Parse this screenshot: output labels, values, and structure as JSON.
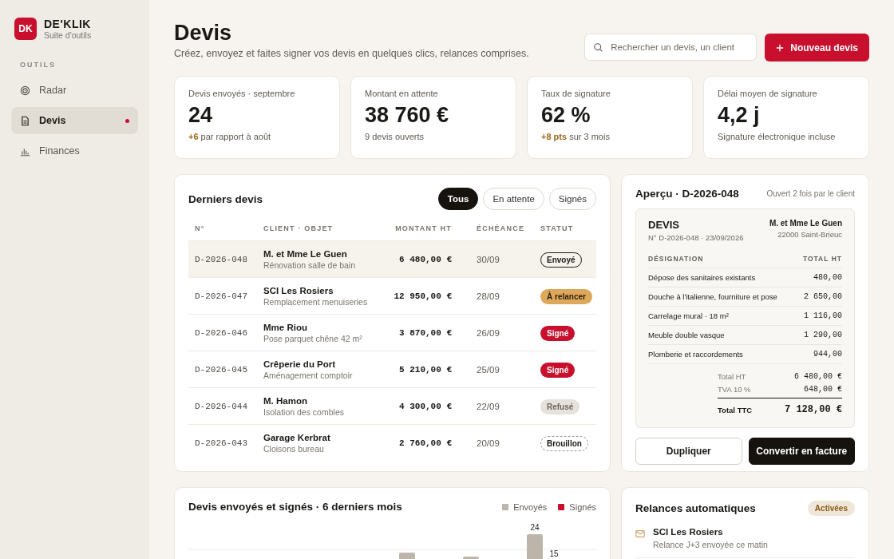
{
  "sidebar": {
    "logo": "DK",
    "brand": "DE'KLIK",
    "tagline": "Suite d'outils",
    "section": "OUTILS",
    "items": [
      {
        "label": "Radar",
        "kind": "radar",
        "selected": false,
        "dot": false
      },
      {
        "label": "Devis",
        "kind": "document",
        "selected": true,
        "dot": true
      },
      {
        "label": "Finances",
        "kind": "chart",
        "selected": false,
        "dot": false
      }
    ]
  },
  "header": {
    "title": "Devis",
    "subtitle": "Créez, envoyez et faites signer vos devis en quelques clics, relances comprises.",
    "search": {
      "placeholder": "Rechercher un devis, un client"
    },
    "new_button": "Nouveau devis"
  },
  "stats": [
    {
      "label": "Devis envoyés · septembre",
      "value": "24",
      "delta": "+6",
      "note": "par rapport à août"
    },
    {
      "label": "Montant en attente",
      "value": "38 760 €",
      "note": "9 devis ouverts"
    },
    {
      "label": "Taux de signature",
      "value": "62 %",
      "delta": "+8 pts",
      "note": "sur 3 mois"
    },
    {
      "label": "Délai moyen de signature",
      "value": "4,2 j",
      "note": "Signature électronique incluse"
    }
  ],
  "quotes": {
    "title": "Derniers devis",
    "filters": [
      {
        "label": "Tous",
        "selected": true
      },
      {
        "label": "En attente",
        "selected": false
      },
      {
        "label": "Signés",
        "selected": false
      }
    ],
    "columns": [
      "N°",
      "CLIENT · OBJET",
      "MONTANT HT",
      "ÉCHÉANCE",
      "STATUT"
    ],
    "rows": [
      {
        "number": "D-2026-048",
        "client": "M. et Mme Le Guen",
        "object": "Rénovation salle de bain",
        "amount": "6 480,00 €",
        "due": "30/09",
        "status": "Envoyé",
        "kind": "sent",
        "selected": true
      },
      {
        "number": "D-2026-047",
        "client": "SCI Les Rosiers",
        "object": "Remplacement menuiseries",
        "amount": "12 950,00 €",
        "due": "28/09",
        "status": "À relancer",
        "kind": "remind",
        "selected": false
      },
      {
        "number": "D-2026-046",
        "client": "Mme Riou",
        "object": "Pose parquet chêne 42 m²",
        "amount": "3 870,00 €",
        "due": "26/09",
        "status": "Signé",
        "kind": "signed",
        "selected": false
      },
      {
        "number": "D-2026-045",
        "client": "Crêperie du Port",
        "object": "Aménagement comptoir",
        "amount": "5 210,00 €",
        "due": "25/09",
        "status": "Signé",
        "kind": "signed",
        "selected": false
      },
      {
        "number": "D-2026-044",
        "client": "M. Hamon",
        "object": "Isolation des combles",
        "amount": "4 300,00 €",
        "due": "22/09",
        "status": "Refusé",
        "kind": "refused",
        "selected": false
      },
      {
        "number": "D-2026-043",
        "client": "Garage Kerbrat",
        "object": "Cloisons bureau",
        "amount": "2 760,00 €",
        "due": "20/09",
        "status": "Brouillon",
        "kind": "draft",
        "selected": false
      }
    ]
  },
  "preview": {
    "title": "Aperçu · D-2026-048",
    "opened": "Ouvert 2 fois par le client",
    "doc": {
      "heading": "DEVIS",
      "ref": "N° D-2026-048 · 23/09/2026",
      "client": "M. et Mme Le Guen",
      "address": "22000 Saint-Brieuc",
      "columns": [
        "DÉSIGNATION",
        "TOTAL HT"
      ],
      "lines": [
        {
          "label": "Dépose des sanitaires existants",
          "amount": "480,00"
        },
        {
          "label": "Douche à l'italienne, fourniture et pose",
          "amount": "2 650,00"
        },
        {
          "label": "Carrelage mural · 18 m²",
          "amount": "1 116,00"
        },
        {
          "label": "Meuble double vasque",
          "amount": "1 290,00"
        },
        {
          "label": "Plomberie et raccordements",
          "amount": "944,00"
        }
      ],
      "totals": [
        {
          "label": "Total HT",
          "value": "6 480,00 €",
          "grand": false
        },
        {
          "label": "TVA 10 %",
          "value": "648,00 €",
          "grand": false
        },
        {
          "label": "Total TTC",
          "value": "7 128,00 €",
          "grand": true
        }
      ]
    },
    "buttons": [
      {
        "label": "Dupliquer",
        "primary": false
      },
      {
        "label": "Convertir en facture",
        "primary": true
      }
    ]
  },
  "chart": {
    "title": "Devis envoyés et signés · 6 derniers mois",
    "legend": [
      {
        "label": "Envoyés",
        "color": "#bdb4aa"
      },
      {
        "label": "Signés",
        "color": "#c8102e"
      }
    ],
    "labels": [
      "24",
      "15"
    ]
  },
  "reminders": {
    "title": "Relances automatiques",
    "status": "Activées",
    "items": [
      {
        "name": "SCI Les Rosiers",
        "note": "Relance J+3 envoyée ce matin"
      }
    ]
  }
}
